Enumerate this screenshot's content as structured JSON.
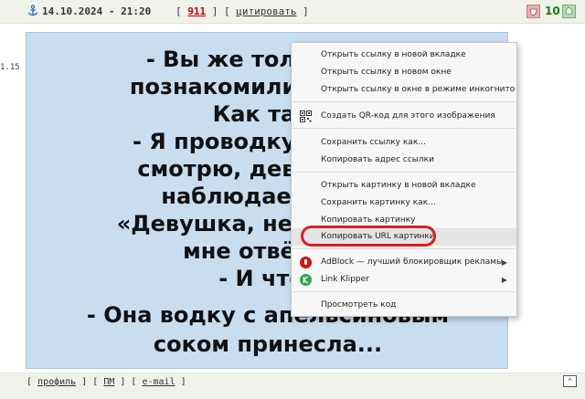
{
  "post": {
    "date": "14.10.2024 - 21:20",
    "reply_number": "911",
    "quote_label": "цитировать",
    "side_number": "1.15",
    "rating": "10"
  },
  "joke_lines": [
    "- Вы же только что",
    "познакомились и уже",
    "Как так?",
    "- Я проводку в одной",
    "смотрю, девушка за",
    "наблюдает. Ну я",
    "«Девушка, не могли бы",
    "мне отвёртку",
    "- И что?",
    "- Она водку с апельсиновым",
    "соком принесла..."
  ],
  "context_menu": {
    "items": [
      {
        "label": "Открыть ссылку в новой вкладке"
      },
      {
        "label": "Открыть ссылку в новом окне"
      },
      {
        "label": "Открыть ссылку в окне в режиме инкогнито"
      },
      {
        "label": "Создать QR-код для этого изображения"
      },
      {
        "label": "Сохранить ссылку как..."
      },
      {
        "label": "Копировать адрес ссылки"
      },
      {
        "label": "Открыть картинку в новой вкладке"
      },
      {
        "label": "Сохранить картинку как..."
      },
      {
        "label": "Копировать картинку"
      },
      {
        "label": "Копировать URL картинки"
      },
      {
        "label": "AdBlock — лучший блокировщик рекламы"
      },
      {
        "label": "Link Klipper"
      },
      {
        "label": "Просмотреть код"
      }
    ]
  },
  "footer": {
    "profile_label": "профиль",
    "pm_label": "ПМ",
    "email_label": "e-mail",
    "scroll_top_label": "^"
  },
  "colors": {
    "header_bg": "#f1f1ec",
    "image_bg": "#c9ddf0",
    "reply_number": "#cc0000",
    "highlight_ellipse": "#d92020",
    "rating_color": "#1a7a1a"
  },
  "icons": [
    "anchor-icon",
    "rate-minus-icon",
    "rate-plus-icon",
    "qr-code-icon",
    "adblock-icon",
    "link-klipper-icon",
    "submenu-arrow-icon",
    "scroll-top-icon"
  ]
}
